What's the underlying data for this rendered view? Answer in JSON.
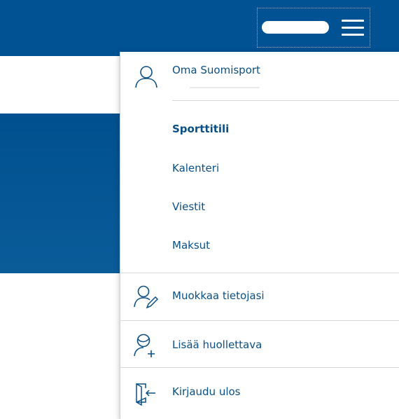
{
  "header": {
    "account_name_redacted": "",
    "menu_icon": "hamburger-icon"
  },
  "menu": {
    "profile": {
      "title": "Oma Suomisport",
      "icon": "user-icon"
    },
    "nav": [
      {
        "label": "Sporttitili",
        "active": true
      },
      {
        "label": "Kalenteri",
        "active": false
      },
      {
        "label": "Viestit",
        "active": false
      },
      {
        "label": "Maksut",
        "active": false
      }
    ],
    "actions": [
      {
        "label": "Muokkaa tietojasi",
        "icon": "edit-user-icon"
      },
      {
        "label": "Lisää huollettava",
        "icon": "add-dependant-icon"
      },
      {
        "label": "Kirjaudu ulos",
        "icon": "logout-icon"
      }
    ]
  },
  "colors": {
    "brand": "#005293",
    "link": "#0a4f86",
    "divider": "#d6d6d6"
  }
}
